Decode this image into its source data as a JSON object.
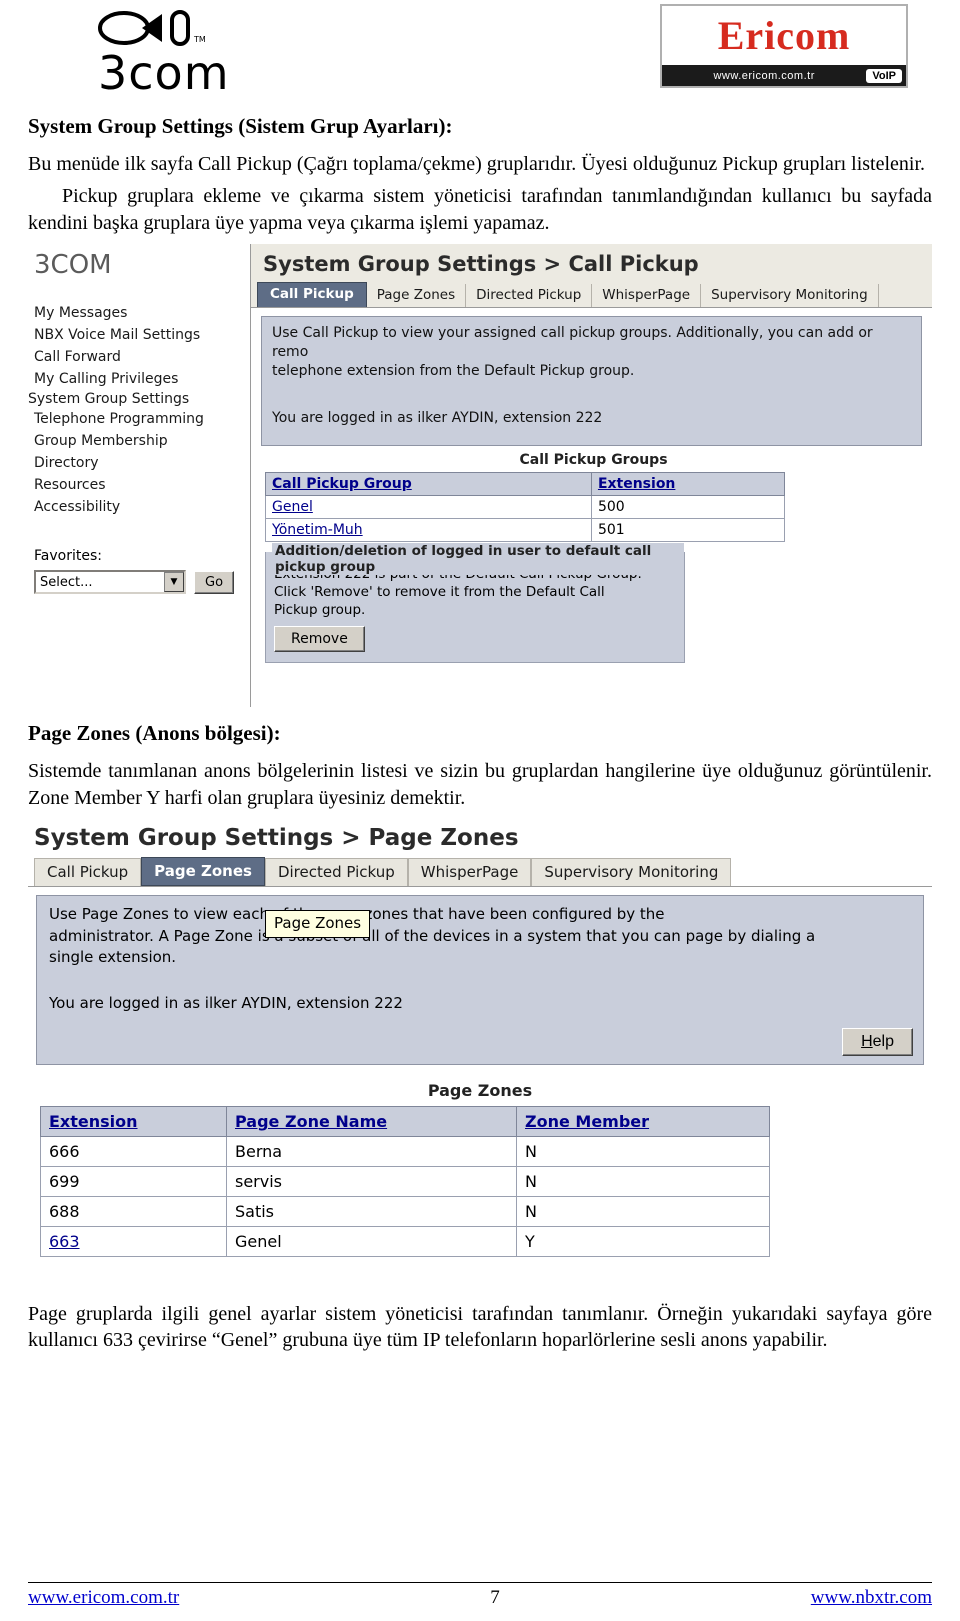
{
  "header": {
    "left_logo": "3com",
    "left_logo_tm": "TM",
    "ericom": {
      "word": "Ericom",
      "site": "www.ericom.com.tr",
      "badge": "VoIP"
    }
  },
  "section1": {
    "title": "System Group Settings (Sistem Grup Ayarları):",
    "p1": "Bu menüde ilk sayfa Call Pickup (Çağrı toplama/çekme) gruplarıdır. Üyesi olduğunuz Pickup grupları listelenir.",
    "p2": "Pickup gruplara ekleme ve çıkarma sistem yöneticisi tarafından tanımlandığından kullanıcı bu sayfada kendini başka gruplara üye yapma veya çıkarma işlemi yapamaz."
  },
  "shot1": {
    "brand": "3COM",
    "nav_items": [
      "My Messages",
      "NBX Voice Mail Settings",
      "Call Forward",
      "My Calling Privileges",
      "System Group Settings",
      "Telephone Programming",
      "Group Membership",
      "Directory",
      "Resources",
      "Accessibility"
    ],
    "nav_active": "System Group Settings",
    "favorites_label": "Favorites:",
    "favorites_select_value": "Select...",
    "go_button": "Go",
    "title": "System Group Settings > Call Pickup",
    "tabs": [
      "Call Pickup",
      "Page Zones",
      "Directed Pickup",
      "WhisperPage",
      "Supervisory Monitoring"
    ],
    "selected_tab": "Call Pickup",
    "info_line1": "Use Call Pickup to view your assigned call pickup groups. Additionally, you can add or remo",
    "info_line2": "telephone extension from the Default Pickup group.",
    "logged_in": "You are logged in as ilker AYDIN, extension 222",
    "table_title": "Call Pickup Groups",
    "table_headers": [
      "Call Pickup Group",
      "Extension"
    ],
    "table_rows": [
      [
        "Genel",
        "500"
      ],
      [
        "Yönetim-Muh",
        "501"
      ]
    ],
    "fieldset_legend": "Addition/deletion of logged in user to default call pickup group",
    "fieldset_line1": "Extension 222 is part of the Default Call Pickup Group.",
    "fieldset_line2": "Click 'Remove' to remove it from the Default Call",
    "fieldset_line3": "Pickup group.",
    "remove_button": "Remove"
  },
  "section2": {
    "title": "Page Zones (Anons bölgesi):",
    "p1": "Sistemde tanımlanan anons bölgelerinin listesi ve sizin bu gruplardan hangilerine üye olduğunuz görüntülenir. Zone Member Y harfi olan gruplara üyesiniz demektir."
  },
  "shot2": {
    "title": "System Group Settings > Page Zones",
    "tabs": [
      "Call Pickup",
      "Page Zones",
      "Directed Pickup",
      "WhisperPage",
      "Supervisory Monitoring"
    ],
    "selected_tab": "Page Zones",
    "tooltip": "Page Zones",
    "info_line1": "Use Page Zones to view                        each of the page zones that have been configured by the",
    "info_line2": "administrator.  A Page Zone is a subset of all of the devices in a system that you can page by dialing a",
    "info_line3": "single extension.",
    "logged_in": "You are logged in as ilker AYDIN, extension 222",
    "help_button": "Help",
    "table_title": "Page Zones",
    "table_headers": [
      "Extension",
      "Page Zone Name",
      "Zone Member"
    ],
    "table_rows": [
      [
        "666",
        "Berna",
        "N"
      ],
      [
        "699",
        "servis",
        "N"
      ],
      [
        "688",
        "Satis",
        "N"
      ],
      [
        "663",
        "Genel",
        "Y"
      ]
    ]
  },
  "section3": {
    "p1": "Page gruplarda ilgili genel ayarlar sistem yöneticisi tarafından tanımlanır. Örneğin yukarıdaki sayfaya göre kullanıcı 633 çevirirse “Genel” grubuna üye tüm IP telefonların hoparlörlerine sesli anons yapabilir."
  },
  "footer": {
    "left": "www.ericom.com.tr",
    "page": "7",
    "right": "www.nbxtr.com"
  }
}
